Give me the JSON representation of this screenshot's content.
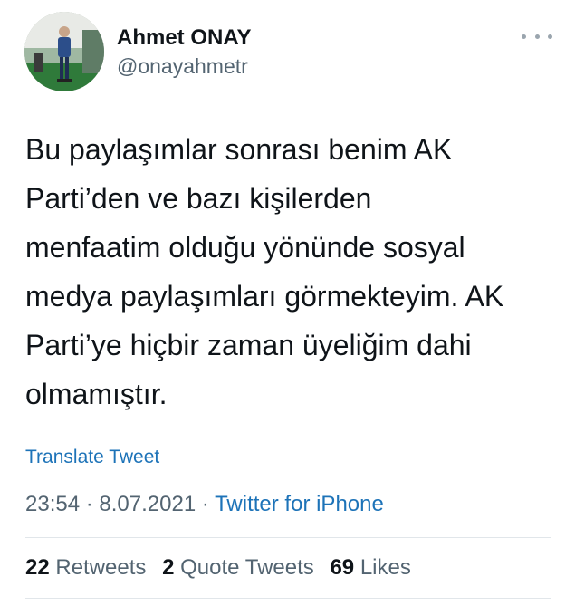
{
  "user": {
    "name": "Ahmet ONAY",
    "handle": "@onayahmetr"
  },
  "tweet": {
    "lines": [
      "Bu paylaşımlar sonrası benim AK",
      "Parti’den ve bazı kişilerden",
      "menfaatim olduğu yönünde sosyal",
      "medya paylaşımları görmekteyim. AK",
      "Parti’ye hiçbir zaman üyeliğim dahi",
      "olmamıştır."
    ]
  },
  "translate_label": "Translate Tweet",
  "meta": {
    "time": "23:54",
    "sep1": " · ",
    "date": "8.07.2021",
    "sep2": " · ",
    "source": "Twitter for iPhone"
  },
  "stats": {
    "retweets_count": "22",
    "retweets_label": "Retweets",
    "quotes_count": "2",
    "quotes_label": "Quote Tweets",
    "likes_count": "69",
    "likes_label": "Likes"
  },
  "icons": {
    "more": "more-dots-icon"
  },
  "colors": {
    "link": "#1d73b8",
    "secondary_text": "#536471",
    "primary_text": "#0f1419",
    "divider": "#e1e6ea"
  }
}
